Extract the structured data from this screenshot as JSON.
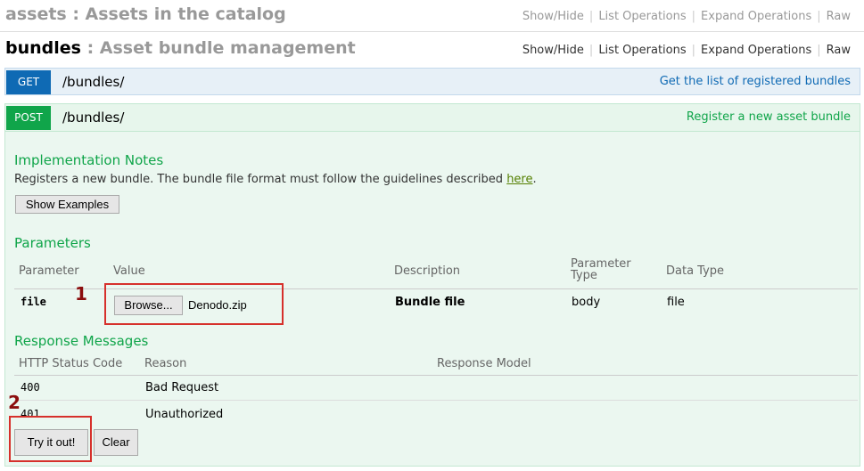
{
  "resources": [
    {
      "name": "assets",
      "description": "Assets in the catalog",
      "links": [
        "Show/Hide",
        "List Operations",
        "Expand Operations",
        "Raw"
      ]
    },
    {
      "name": "bundles",
      "description": "Asset bundle management",
      "links": [
        "Show/Hide",
        "List Operations",
        "Expand Operations",
        "Raw"
      ]
    }
  ],
  "colors": {
    "get_method": "#0f6ab4",
    "post_method": "#10a54a",
    "annotation": "#d6302b"
  },
  "operations": {
    "get": {
      "method": "GET",
      "path": "/bundles/",
      "summary": "Get the list of registered bundles"
    },
    "post": {
      "method": "POST",
      "path": "/bundles/",
      "summary": "Register a new asset bundle",
      "implementation_notes": {
        "heading": "Implementation Notes",
        "text": "Registers a new bundle. The bundle file format must follow the guidelines described ",
        "link_text": "here",
        "trailing": ".",
        "show_examples_label": "Show Examples"
      },
      "parameters": {
        "heading": "Parameters",
        "columns": [
          "Parameter",
          "Value",
          "Description",
          "Parameter Type",
          "Data Type"
        ],
        "column_type_line1": "Parameter",
        "column_type_line2": "Type",
        "rows": [
          {
            "parameter": "file",
            "browse_label": "Browse...",
            "file_name": "Denodo.zip",
            "description": "Bundle file",
            "parameter_type": "body",
            "data_type": "file"
          }
        ]
      },
      "responses": {
        "heading": "Response Messages",
        "columns": [
          "HTTP Status Code",
          "Reason",
          "Response Model"
        ],
        "rows": [
          {
            "code": "400",
            "reason": "Bad Request"
          },
          {
            "code": "401",
            "reason": "Unauthorized"
          }
        ]
      },
      "try_label": "Try it out!",
      "clear_label": "Clear"
    }
  },
  "annotations": [
    "1",
    "2"
  ]
}
